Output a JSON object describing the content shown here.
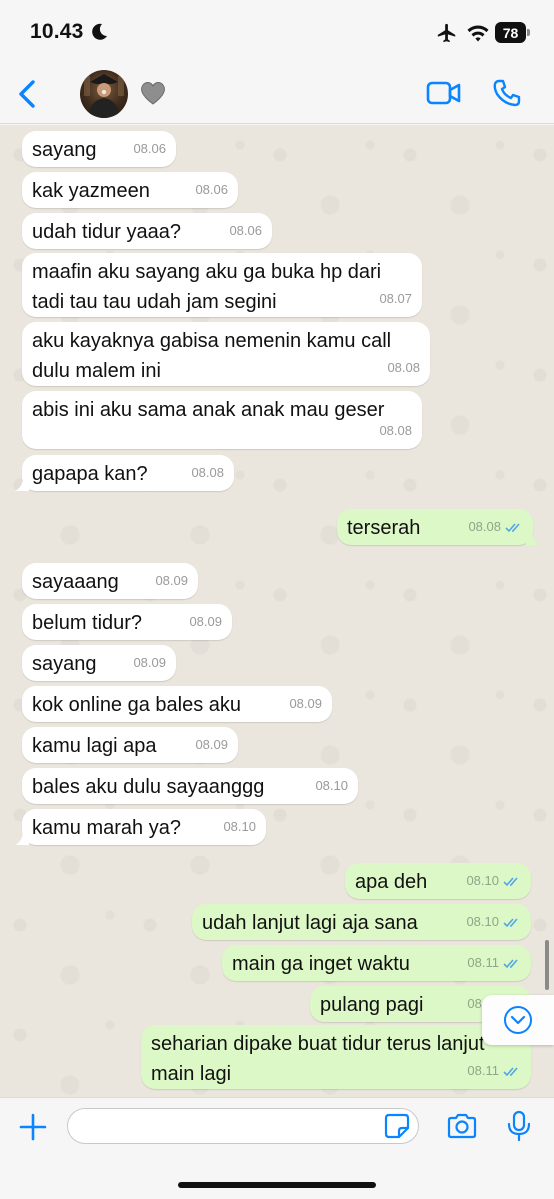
{
  "status_bar": {
    "time": "10.43",
    "battery": "78"
  },
  "header": {
    "contact_name": ""
  },
  "messages": [
    {
      "dir": "in",
      "text": "sayang",
      "time": "08.06",
      "tail": false
    },
    {
      "dir": "in",
      "text": "kak yazmeen",
      "time": "08.06",
      "tail": false
    },
    {
      "dir": "in",
      "text": "udah tidur yaaa?",
      "time": "08.06",
      "tail": false
    },
    {
      "dir": "in",
      "text": "maafin aku sayang aku ga buka hp dari tadi tau tau udah jam segini",
      "time": "08.07",
      "tail": false
    },
    {
      "dir": "in",
      "text": "aku kayaknya gabisa nemenin kamu call dulu malem ini",
      "time": "08.08",
      "tail": false
    },
    {
      "dir": "in",
      "text": "abis ini aku sama anak anak mau geser",
      "time": "08.08",
      "tail": false
    },
    {
      "dir": "in",
      "text": "gapapa kan?",
      "time": "08.08",
      "tail": true
    },
    {
      "dir": "out",
      "text": "terserah",
      "time": "08.08",
      "tail": true,
      "read": true
    },
    {
      "dir": "in",
      "text": "sayaaang",
      "time": "08.09",
      "tail": false
    },
    {
      "dir": "in",
      "text": "belum tidur?",
      "time": "08.09",
      "tail": false
    },
    {
      "dir": "in",
      "text": "sayang",
      "time": "08.09",
      "tail": false
    },
    {
      "dir": "in",
      "text": "kok online ga bales aku",
      "time": "08.09",
      "tail": false
    },
    {
      "dir": "in",
      "text": "kamu lagi apa",
      "time": "08.09",
      "tail": false
    },
    {
      "dir": "in",
      "text": "bales aku dulu sayaanggg",
      "time": "08.10",
      "tail": false
    },
    {
      "dir": "in",
      "text": "kamu marah ya?",
      "time": "08.10",
      "tail": true
    },
    {
      "dir": "out",
      "text": "apa deh",
      "time": "08.10",
      "tail": false,
      "read": true
    },
    {
      "dir": "out",
      "text": "udah lanjut lagi aja sana",
      "time": "08.10",
      "tail": false,
      "read": true
    },
    {
      "dir": "out",
      "text": "main ga inget waktu",
      "time": "08.11",
      "tail": false,
      "read": true
    },
    {
      "dir": "out",
      "text": "pulang pagi",
      "time": "08.11",
      "tail": false,
      "read": true
    },
    {
      "dir": "out",
      "text": "seharian dipake buat tidur terus lanjut main lagi",
      "time": "08.11",
      "tail": false,
      "read": true
    }
  ],
  "input": {
    "placeholder": ""
  },
  "colors": {
    "accent": "#0a84ff",
    "incoming_bubble": "#ffffff",
    "outgoing_bubble": "#dcf8c6",
    "read_ticks": "#53a6e4",
    "chat_background": "#eae5dd"
  },
  "icons": [
    "moon-icon",
    "airplane-icon",
    "wifi-icon",
    "back-chevron-icon",
    "heart-icon",
    "video-call-icon",
    "phone-icon",
    "scroll-down-icon",
    "plus-icon",
    "sticker-icon",
    "camera-icon",
    "microphone-icon"
  ]
}
